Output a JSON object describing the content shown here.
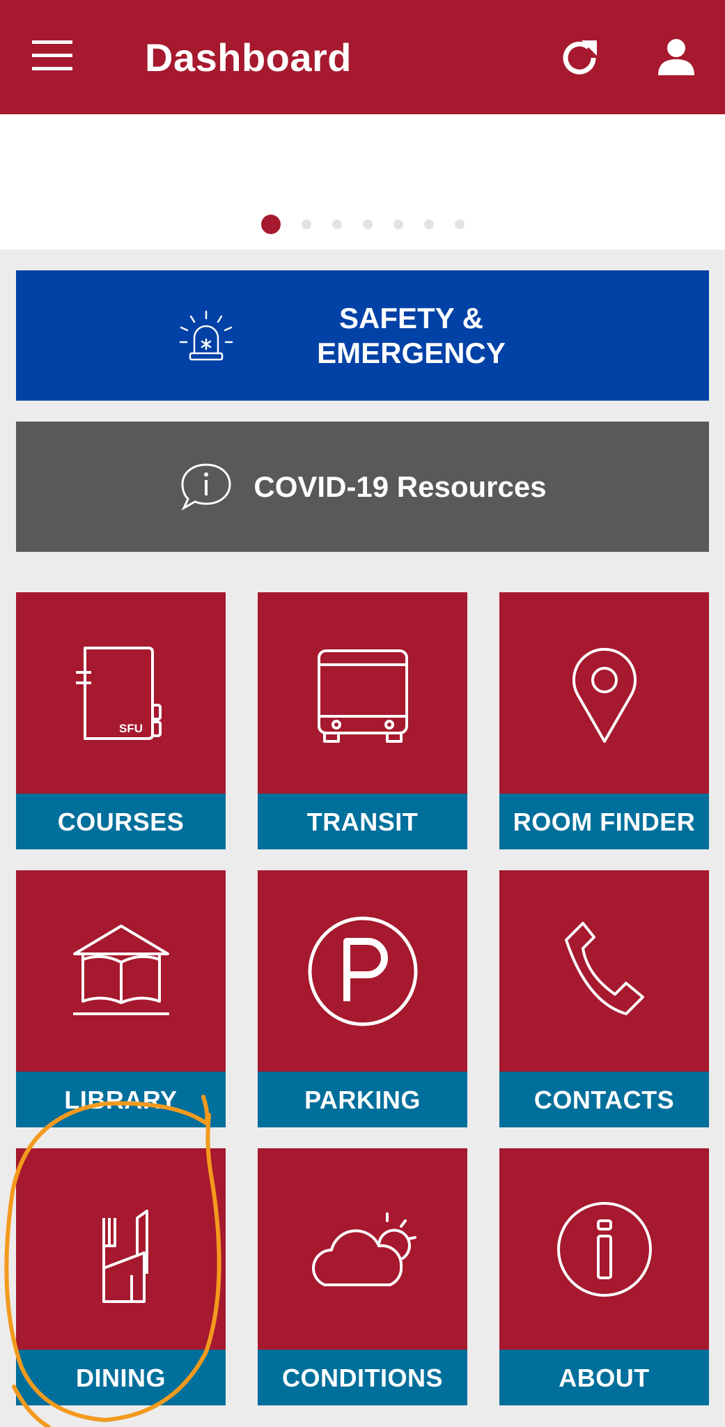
{
  "appbar": {
    "title": "Dashboard",
    "background": "#a6192e",
    "icons": {
      "menu": "hamburger-menu-icon",
      "refresh": "refresh-icon",
      "profile": "user-profile-icon"
    }
  },
  "carousel": {
    "page_count": 7,
    "active_index": 0
  },
  "banners": {
    "safety": {
      "label_line1": "SAFETY &",
      "label_line2": "EMERGENCY",
      "icon": "siren-icon",
      "color": "#0241a6"
    },
    "covid": {
      "label": "COVID-19 Resources",
      "icon": "info-speech-bubble-icon",
      "color": "#58595b"
    }
  },
  "tiles": [
    {
      "label": "COURSES",
      "icon": "sfu-notebook-icon",
      "courses_icon_text": "SFU"
    },
    {
      "label": "TRANSIT",
      "icon": "bus-icon"
    },
    {
      "label": "ROOM FINDER",
      "icon": "map-pin-icon"
    },
    {
      "label": "LIBRARY",
      "icon": "library-book-icon"
    },
    {
      "label": "PARKING",
      "icon": "parking-icon"
    },
    {
      "label": "CONTACTS",
      "icon": "phone-handset-icon"
    },
    {
      "label": "DINING",
      "icon": "fork-knife-icon"
    },
    {
      "label": "CONDITIONS",
      "icon": "weather-cloud-sun-icon"
    },
    {
      "label": "ABOUT",
      "icon": "info-circle-icon"
    }
  ],
  "colors": {
    "tile": "#a6192e",
    "tile_label_bar": "#006f9b",
    "highlight": "#f39a1e"
  }
}
